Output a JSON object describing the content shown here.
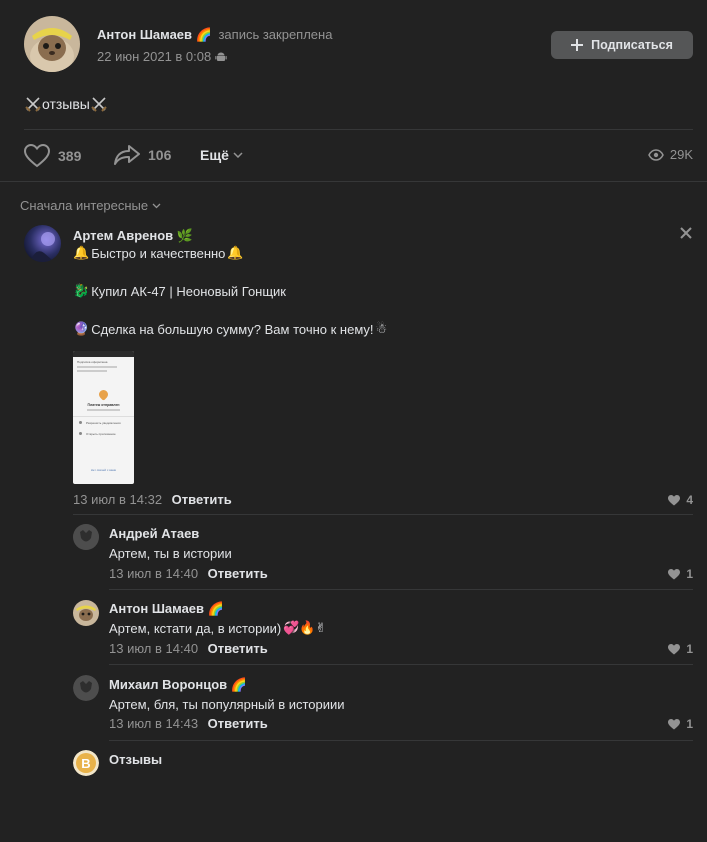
{
  "post": {
    "author": "Антон Шамаев",
    "author_emoji": "🌈",
    "pinned": "запись закреплена",
    "date": "22 июн 2021 в 0:08",
    "subscribe": "Подписаться",
    "text": "отзывы",
    "likes": "389",
    "shares": "106",
    "more": "Ещё",
    "views": "29K"
  },
  "comments_sort": "Сначала интересные",
  "comments": [
    {
      "author": "Артем Авренов",
      "author_emoji": "🌿",
      "line1": "Быстро и качественно",
      "line2": "Купил АК-47 | Неоновый Гонщик",
      "line3": "Сделка на большую сумму? Вам точно к нему!",
      "meta": "13 июл в 14:32",
      "reply": "Ответить",
      "likes": "4",
      "attachment": {
        "title": "Подписка оформлена",
        "status": "Платеж отправлен",
        "item1": "Разрешить уведомления",
        "item2": "Открыть приложение",
        "footer": "Нет связей с вами"
      }
    }
  ],
  "replies": [
    {
      "author": "Андрей Атаев",
      "author_emoji": "",
      "text": "Артем, ты в истории",
      "meta": "13 июл в 14:40",
      "reply": "Ответить",
      "likes": "1"
    },
    {
      "author": "Антон Шамаев",
      "author_emoji": "🌈",
      "text": "Артем, кстати да, в истории)",
      "text_emoji": "💞🔥✌",
      "meta": "13 июл в 14:40",
      "reply": "Ответить",
      "likes": "1"
    },
    {
      "author": "Михаил Воронцов",
      "author_emoji": "🌈",
      "text": "Артем, бля, ты популярный в историии",
      "meta": "13 июл в 14:43",
      "reply": "Ответить",
      "likes": "1"
    },
    {
      "author": "Отзывы",
      "author_emoji": "",
      "text": "",
      "meta": "",
      "reply": "",
      "likes": ""
    }
  ],
  "colors": {
    "background": "#222222",
    "text": "#e1e3e6",
    "secondary": "#939393",
    "divider": "#363738",
    "button": "#555657"
  }
}
